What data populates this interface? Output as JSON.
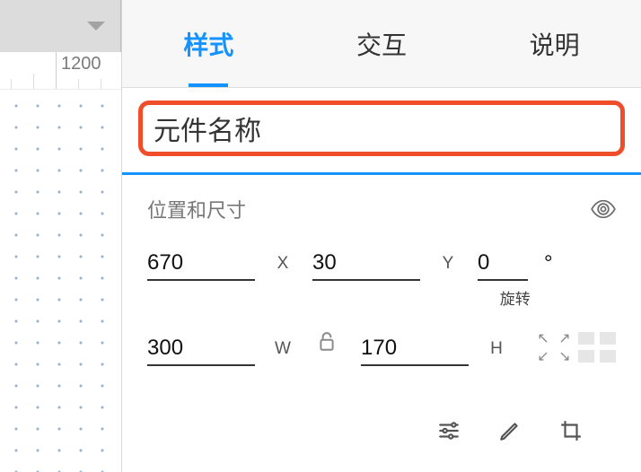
{
  "ruler": {
    "major_label": "1200"
  },
  "tabs": {
    "style": "样式",
    "interaction": "交互",
    "description": "说明"
  },
  "name_field": {
    "placeholder": "元件名称"
  },
  "section": {
    "title": "位置和尺寸",
    "x_value": "670",
    "x_suffix": "X",
    "y_value": "30",
    "y_suffix": "Y",
    "rotation_value": "0",
    "rotation_degree": "°",
    "rotation_label": "旋转",
    "w_value": "300",
    "w_suffix": "W",
    "h_value": "170",
    "h_suffix": "H"
  }
}
